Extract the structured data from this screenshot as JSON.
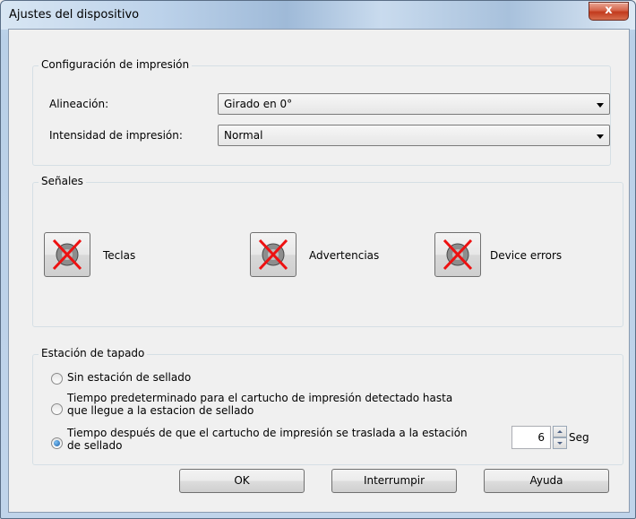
{
  "window": {
    "title": "Ajustes del dispositivo",
    "close_glyph": "x"
  },
  "print_config": {
    "group_label": "Configuración de impresión",
    "alignment_label": "Alineación:",
    "alignment_value": "Girado en 0°",
    "intensity_label": "Intensidad de impresión:",
    "intensity_value": "Normal"
  },
  "signals": {
    "group_label": "Señales",
    "items": [
      {
        "label": "Teclas",
        "icon": "speaker-muted-icon"
      },
      {
        "label": "Advertencias",
        "icon": "speaker-muted-icon"
      },
      {
        "label": "Device errors",
        "icon": "speaker-muted-icon"
      }
    ]
  },
  "capping": {
    "group_label": "Estación de tapado",
    "options": [
      {
        "line1": "Sin estación de sellado",
        "line2": "",
        "checked": false
      },
      {
        "line1": "Tiempo predeterminado para el cartucho de impresión detectado hasta",
        "line2": "que llegue a la estacion de sellado",
        "checked": false
      },
      {
        "line1": "Tiempo después de que el cartucho de impresión se traslada a la estación",
        "line2": "de sellado",
        "checked": true
      }
    ],
    "seconds_value": "6",
    "seconds_unit": "Seg"
  },
  "buttons": {
    "ok": "OK",
    "cancel": "Interrumpir",
    "help": "Ayuda"
  }
}
